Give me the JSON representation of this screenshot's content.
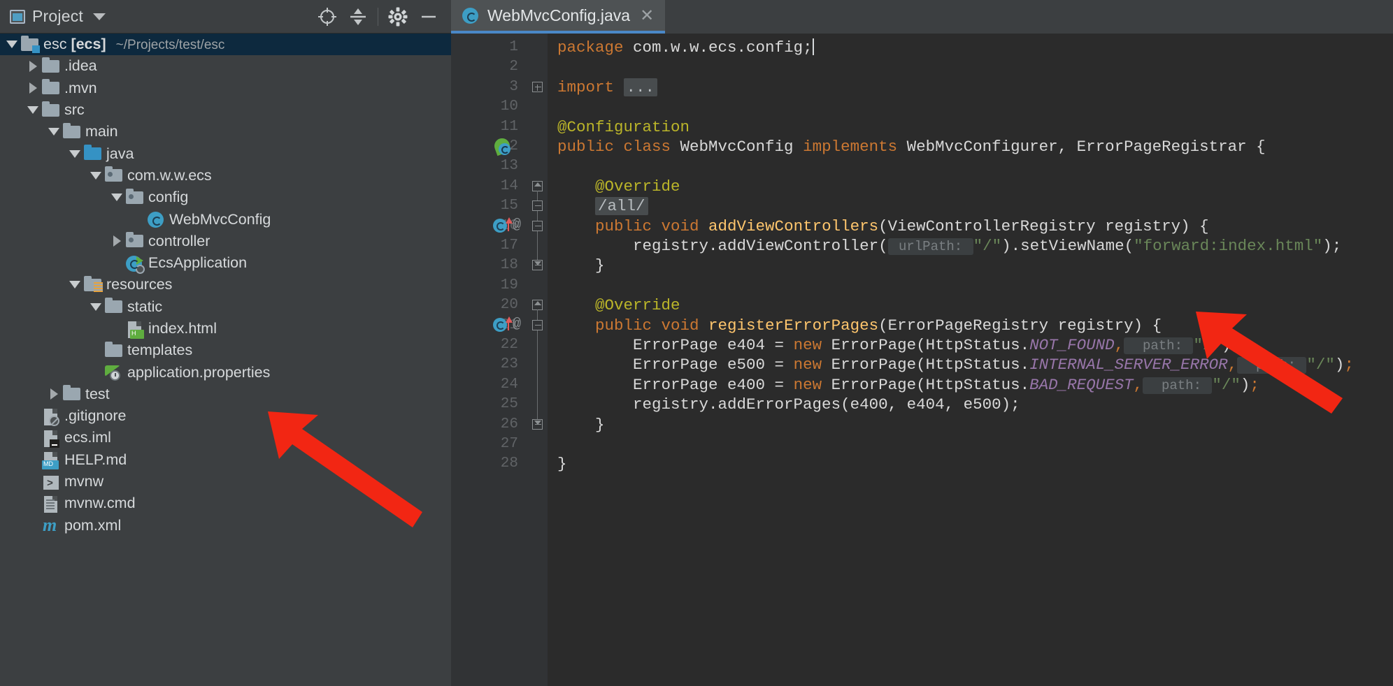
{
  "toolwindow": {
    "title": "Project",
    "dropdown_icon": "chevron-down-icon",
    "buttons": [
      {
        "name": "locate-icon",
        "label": "Select Opened File"
      },
      {
        "name": "collapse-all-icon",
        "label": "Collapse All"
      },
      {
        "name": "gear-icon",
        "label": "Settings"
      },
      {
        "name": "minimize-icon",
        "label": "Hide"
      }
    ]
  },
  "tree": {
    "items": [
      {
        "label": "esc [ecs]",
        "sublabel": "~/Projects/test/esc",
        "depth": 0,
        "expand": "down",
        "icon": "module-folder-icon",
        "selected": true,
        "bold_part": "[ecs]"
      },
      {
        "label": ".idea",
        "sublabel": "",
        "depth": 1,
        "expand": "right",
        "icon": "folder-icon",
        "selected": false
      },
      {
        "label": ".mvn",
        "sublabel": "",
        "depth": 1,
        "expand": "right",
        "icon": "folder-icon",
        "selected": false
      },
      {
        "label": "src",
        "sublabel": "",
        "depth": 1,
        "expand": "down",
        "icon": "folder-icon",
        "selected": false
      },
      {
        "label": "main",
        "sublabel": "",
        "depth": 2,
        "expand": "down",
        "icon": "folder-icon",
        "selected": false
      },
      {
        "label": "java",
        "sublabel": "",
        "depth": 3,
        "expand": "down",
        "icon": "source-root-folder-icon",
        "selected": false
      },
      {
        "label": "com.w.w.ecs",
        "sublabel": "",
        "depth": 4,
        "expand": "down",
        "icon": "package-icon",
        "selected": false
      },
      {
        "label": "config",
        "sublabel": "",
        "depth": 5,
        "expand": "down",
        "icon": "package-icon",
        "selected": false
      },
      {
        "label": "WebMvcConfig",
        "sublabel": "",
        "depth": 6,
        "expand": "none",
        "icon": "java-class-icon",
        "selected": false
      },
      {
        "label": "controller",
        "sublabel": "",
        "depth": 5,
        "expand": "right",
        "icon": "package-icon",
        "selected": false
      },
      {
        "label": "EcsApplication",
        "sublabel": "",
        "depth": 5,
        "expand": "none",
        "icon": "spring-boot-class-icon",
        "selected": false
      },
      {
        "label": "resources",
        "sublabel": "",
        "depth": 3,
        "expand": "down",
        "icon": "resources-root-folder-icon",
        "selected": false
      },
      {
        "label": "static",
        "sublabel": "",
        "depth": 4,
        "expand": "down",
        "icon": "folder-icon",
        "selected": false
      },
      {
        "label": "index.html",
        "sublabel": "",
        "depth": 5,
        "expand": "none",
        "icon": "html-file-icon",
        "selected": false
      },
      {
        "label": "templates",
        "sublabel": "",
        "depth": 4,
        "expand": "none",
        "icon": "folder-icon",
        "selected": false
      },
      {
        "label": "application.properties",
        "sublabel": "",
        "depth": 4,
        "expand": "none",
        "icon": "spring-properties-icon",
        "selected": false
      },
      {
        "label": "test",
        "sublabel": "",
        "depth": 2,
        "expand": "right",
        "icon": "folder-icon",
        "selected": false
      },
      {
        "label": ".gitignore",
        "sublabel": "",
        "depth": 1,
        "expand": "none",
        "icon": "gitignore-file-icon",
        "selected": false
      },
      {
        "label": "ecs.iml",
        "sublabel": "",
        "depth": 1,
        "expand": "none",
        "icon": "iml-file-icon",
        "selected": false
      },
      {
        "label": "HELP.md",
        "sublabel": "",
        "depth": 1,
        "expand": "none",
        "icon": "markdown-file-icon",
        "selected": false
      },
      {
        "label": "mvnw",
        "sublabel": "",
        "depth": 1,
        "expand": "none",
        "icon": "shell-script-icon",
        "selected": false
      },
      {
        "label": "mvnw.cmd",
        "sublabel": "",
        "depth": 1,
        "expand": "none",
        "icon": "text-file-icon",
        "selected": false
      },
      {
        "label": "pom.xml",
        "sublabel": "",
        "depth": 1,
        "expand": "none",
        "icon": "maven-file-icon",
        "selected": false
      }
    ]
  },
  "editor": {
    "tab": {
      "label": "WebMvcConfig.java",
      "icon": "java-class-icon",
      "close_icon": "close-icon",
      "active": true
    },
    "line_numbers": [
      "1",
      "2",
      "3",
      "10",
      "11",
      "12",
      "13",
      "14",
      "15",
      "16",
      "17",
      "18",
      "19",
      "20",
      "21",
      "22",
      "23",
      "24",
      "25",
      "26",
      "27",
      "28"
    ],
    "code_lines": [
      {
        "n": "1",
        "segments": [
          {
            "t": "package ",
            "c": "kw"
          },
          {
            "t": "com.w.w.ecs.config;",
            "c": "white"
          }
        ],
        "caret": true
      },
      {
        "n": "2",
        "segments": []
      },
      {
        "n": "3",
        "segments": [
          {
            "t": "import ",
            "c": "kw"
          },
          {
            "t": "...",
            "c": "fold"
          }
        ]
      },
      {
        "n": "10",
        "segments": []
      },
      {
        "n": "11",
        "segments": [
          {
            "t": "@Configuration",
            "c": "anno"
          }
        ]
      },
      {
        "n": "12",
        "segments": [
          {
            "t": "public class ",
            "c": "kw"
          },
          {
            "t": "WebMvcConfig ",
            "c": "white"
          },
          {
            "t": "implements ",
            "c": "kw"
          },
          {
            "t": "WebMvcConfigurer, ErrorPageRegistrar {",
            "c": "white"
          }
        ]
      },
      {
        "n": "13",
        "segments": []
      },
      {
        "n": "14",
        "segments": [
          {
            "t": "    @Override",
            "c": "anno"
          }
        ]
      },
      {
        "n": "15",
        "segments": [
          {
            "t": "    ",
            "c": "plain"
          },
          {
            "t": "/all/",
            "c": "fold"
          }
        ]
      },
      {
        "n": "16",
        "segments": [
          {
            "t": "    ",
            "c": "plain"
          },
          {
            "t": "public void ",
            "c": "kw"
          },
          {
            "t": "addViewControllers",
            "c": "mth"
          },
          {
            "t": "(ViewControllerRegistry registry) {",
            "c": "white"
          }
        ]
      },
      {
        "n": "17",
        "segments": [
          {
            "t": "        registry.addViewController(",
            "c": "white"
          },
          {
            "t": " urlPath: ",
            "c": "hint"
          },
          {
            "t": "\"/\"",
            "c": "str"
          },
          {
            "t": ").setViewName(",
            "c": "white"
          },
          {
            "t": "\"forward:index.html\"",
            "c": "str"
          },
          {
            "t": ");",
            "c": "white"
          }
        ]
      },
      {
        "n": "18",
        "segments": [
          {
            "t": "    }",
            "c": "white"
          }
        ]
      },
      {
        "n": "19",
        "segments": []
      },
      {
        "n": "20",
        "segments": [
          {
            "t": "    @Override",
            "c": "anno"
          }
        ]
      },
      {
        "n": "21",
        "segments": [
          {
            "t": "    ",
            "c": "plain"
          },
          {
            "t": "public void ",
            "c": "kw"
          },
          {
            "t": "registerErrorPages",
            "c": "mth"
          },
          {
            "t": "(ErrorPageRegistry registry) {",
            "c": "white"
          }
        ]
      },
      {
        "n": "22",
        "segments": [
          {
            "t": "        ErrorPage e404 = ",
            "c": "white"
          },
          {
            "t": "new ",
            "c": "kw"
          },
          {
            "t": "ErrorPage(HttpStatus.",
            "c": "white"
          },
          {
            "t": "NOT_FOUND",
            "c": "stat"
          },
          {
            "t": ",",
            "c": "kw"
          },
          {
            "t": "  path: ",
            "c": "hint"
          },
          {
            "t": "\"/\"",
            "c": "str"
          },
          {
            "t": ")",
            "c": "white"
          },
          {
            "t": ";",
            "c": "kw"
          }
        ]
      },
      {
        "n": "23",
        "segments": [
          {
            "t": "        ErrorPage e500 = ",
            "c": "white"
          },
          {
            "t": "new ",
            "c": "kw"
          },
          {
            "t": "ErrorPage(HttpStatus.",
            "c": "white"
          },
          {
            "t": "INTERNAL_SERVER_ERROR",
            "c": "stat"
          },
          {
            "t": ",",
            "c": "kw"
          },
          {
            "t": "  path: ",
            "c": "hint"
          },
          {
            "t": "\"/\"",
            "c": "str"
          },
          {
            "t": ")",
            "c": "white"
          },
          {
            "t": ";",
            "c": "kw"
          }
        ]
      },
      {
        "n": "24",
        "segments": [
          {
            "t": "        ErrorPage e400 = ",
            "c": "white"
          },
          {
            "t": "new ",
            "c": "kw"
          },
          {
            "t": "ErrorPage(HttpStatus.",
            "c": "white"
          },
          {
            "t": "BAD_REQUEST",
            "c": "stat"
          },
          {
            "t": ",",
            "c": "kw"
          },
          {
            "t": "  path: ",
            "c": "hint"
          },
          {
            "t": "\"/\"",
            "c": "str"
          },
          {
            "t": ")",
            "c": "white"
          },
          {
            "t": ";",
            "c": "kw"
          }
        ]
      },
      {
        "n": "25",
        "segments": [
          {
            "t": "        registry.addErrorPages(e400, e404, e500);",
            "c": "white"
          }
        ]
      },
      {
        "n": "26",
        "segments": [
          {
            "t": "    }",
            "c": "white"
          }
        ]
      },
      {
        "n": "27",
        "segments": []
      },
      {
        "n": "28",
        "segments": [
          {
            "t": "}",
            "c": "white"
          }
        ]
      }
    ],
    "gutter_icons": [
      {
        "line": "12",
        "icon": "spring-bean-icon"
      },
      {
        "line": "16",
        "icon": "implementing-method-icon",
        "at": "@"
      },
      {
        "line": "21",
        "icon": "implementing-method-icon",
        "at": "@"
      }
    ]
  },
  "annotations": {
    "arrow_color": "#f22613",
    "arrows": [
      {
        "name": "arrow-pointing-to-index-html",
        "target": "index.html"
      },
      {
        "name": "arrow-pointing-to-forward-index-html",
        "target": "\"forward:index.html\""
      }
    ]
  },
  "colors": {
    "accent": "#4a88c7",
    "panel_bg": "#3c3f41",
    "editor_bg": "#2b2b2b",
    "gutter_bg": "#313335",
    "selection_bg": "#0d293e",
    "keyword": "#cc7832",
    "annotation": "#bbb529",
    "method": "#ffc66d",
    "string": "#6a8759",
    "static_field": "#9876aa",
    "text": "#a9b7c6"
  }
}
